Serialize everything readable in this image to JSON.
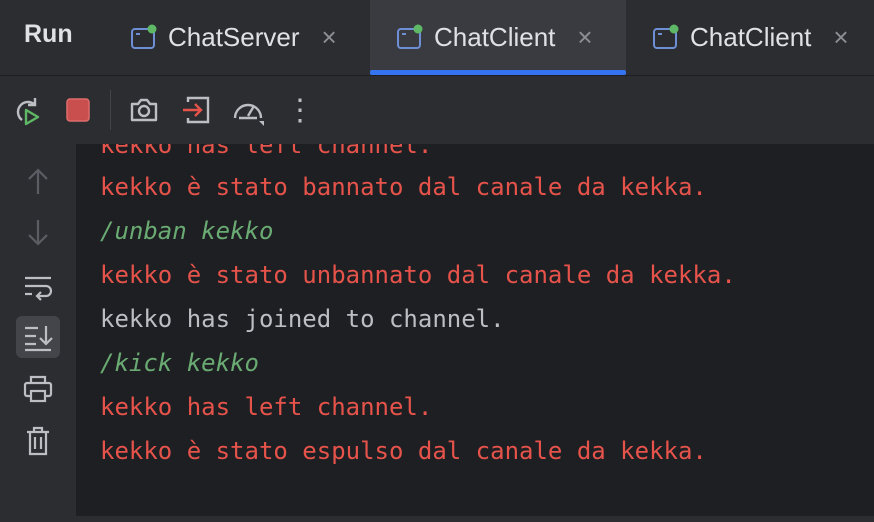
{
  "run_panel": {
    "title": "Run"
  },
  "tabs": [
    {
      "label": "ChatServer",
      "close": "×",
      "active": false
    },
    {
      "label": "ChatClient",
      "close": "×",
      "active": true
    },
    {
      "label": "ChatClient",
      "close": "×",
      "active": false
    }
  ],
  "toolbar": {
    "icons": [
      "rerun-icon",
      "stop-icon",
      "screenshot-icon",
      "login-icon",
      "profiler-icon",
      "more-options-icon"
    ],
    "more": "⋮"
  },
  "sidebar": {
    "icons": [
      "arrow-up-icon",
      "arrow-down-icon",
      "soft-wrap-icon",
      "scroll-to-end-icon",
      "print-icon",
      "trash-icon"
    ]
  },
  "console": {
    "lines": [
      {
        "text": "kekko has left channel.",
        "kind": "error"
      },
      {
        "text": "kekko è stato bannato dal canale da kekka.",
        "kind": "error"
      },
      {
        "text": "/unban kekko",
        "kind": "input"
      },
      {
        "text": "kekko è stato unbannato dal canale da kekka.",
        "kind": "error"
      },
      {
        "text": "kekko has joined to channel.",
        "kind": "output"
      },
      {
        "text": "/kick kekko",
        "kind": "input"
      },
      {
        "text": "kekko has left channel.",
        "kind": "error"
      },
      {
        "text": "kekko è stato espulso dal canale da kekka.",
        "kind": "error"
      }
    ]
  },
  "colors": {
    "error_text": "#e5534b",
    "input_text": "#6aab73",
    "normal_text": "#bcbec4",
    "accent": "#3574f0",
    "running_dot": "#5fb865"
  }
}
